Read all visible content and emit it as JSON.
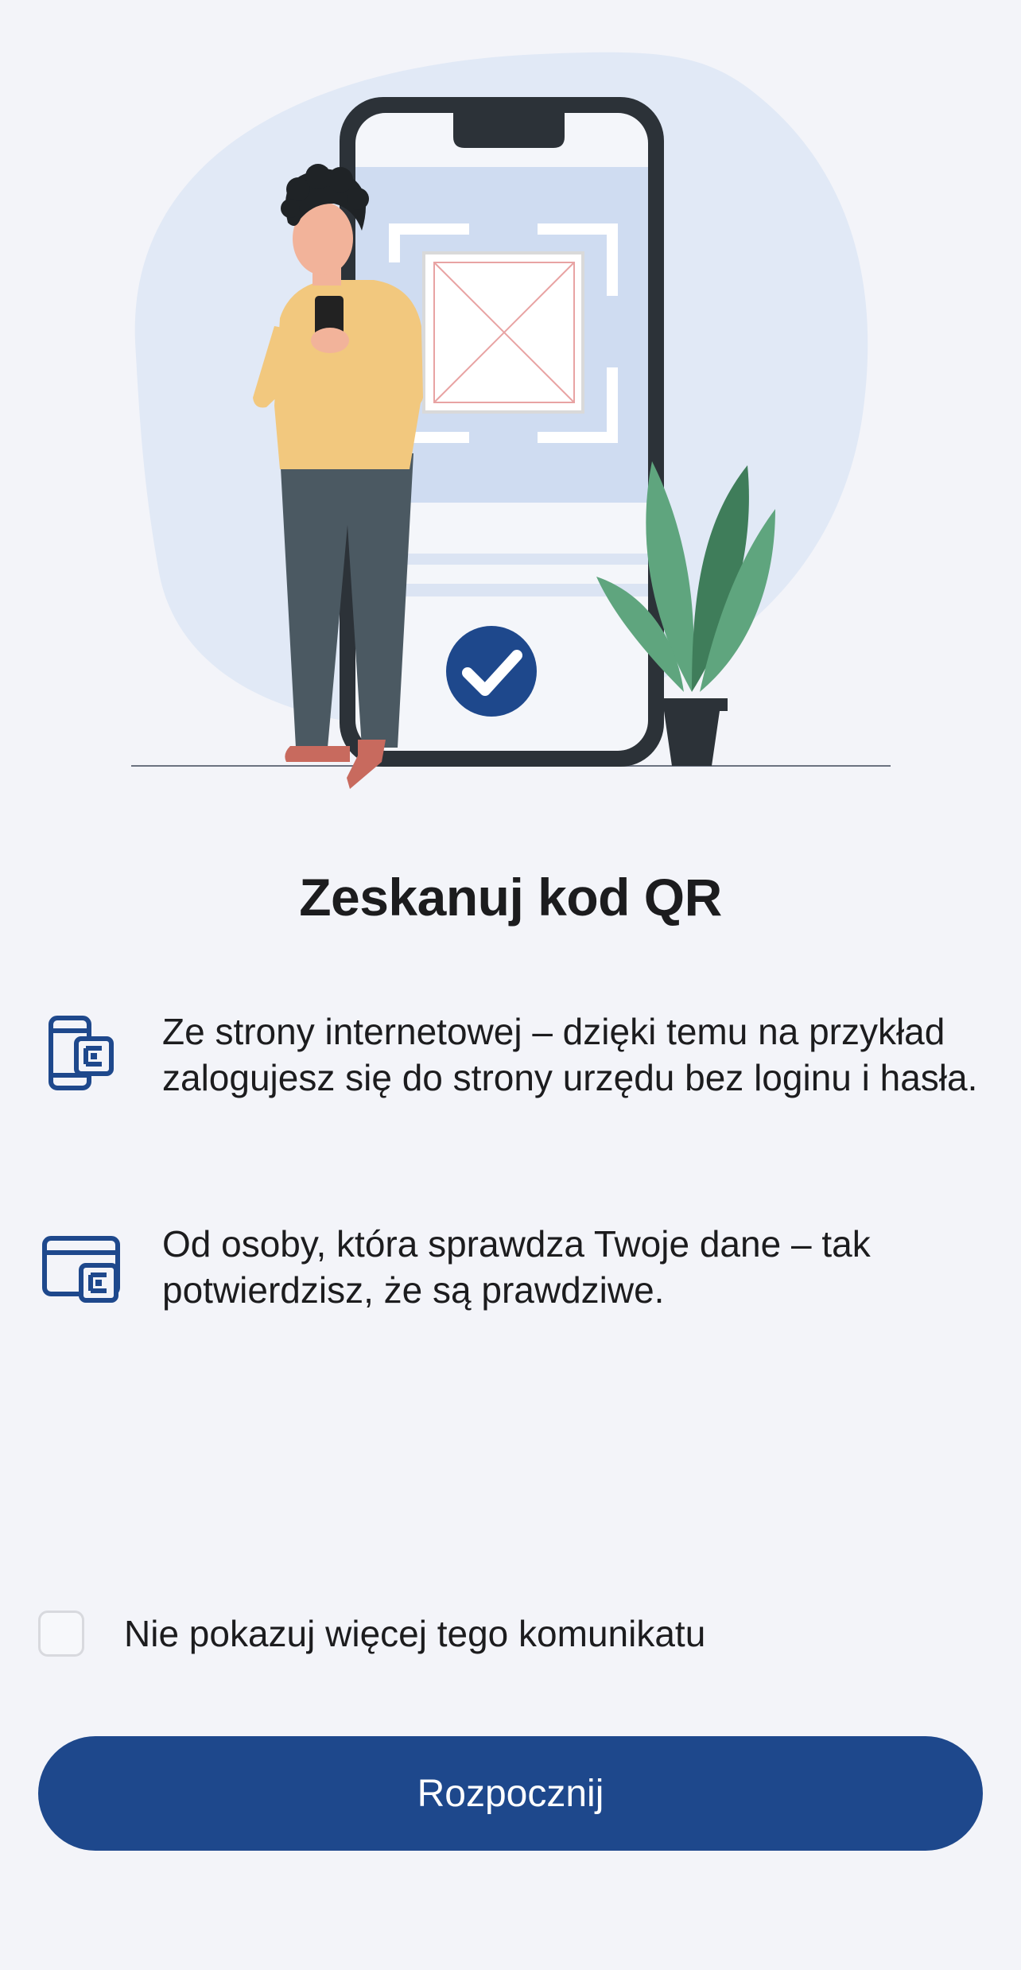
{
  "title": "Zeskanuj kod QR",
  "info_items": [
    {
      "icon": "phone-qr-icon",
      "text": "Ze strony internetowej – dzięki temu na przykład zalogujesz się do strony urzędu bez loginu i hasła."
    },
    {
      "icon": "browser-qr-icon",
      "text": "Od osoby, która sprawdza Twoje dane – tak potwierdzisz, że są prawdziwe."
    }
  ],
  "checkbox": {
    "label": "Nie pokazuj więcej tego komunikatu",
    "checked": false
  },
  "button": {
    "label": "Rozpocznij"
  },
  "colors": {
    "background": "#f3f4f9",
    "primary": "#1e488c",
    "text": "#1c1c1e"
  }
}
